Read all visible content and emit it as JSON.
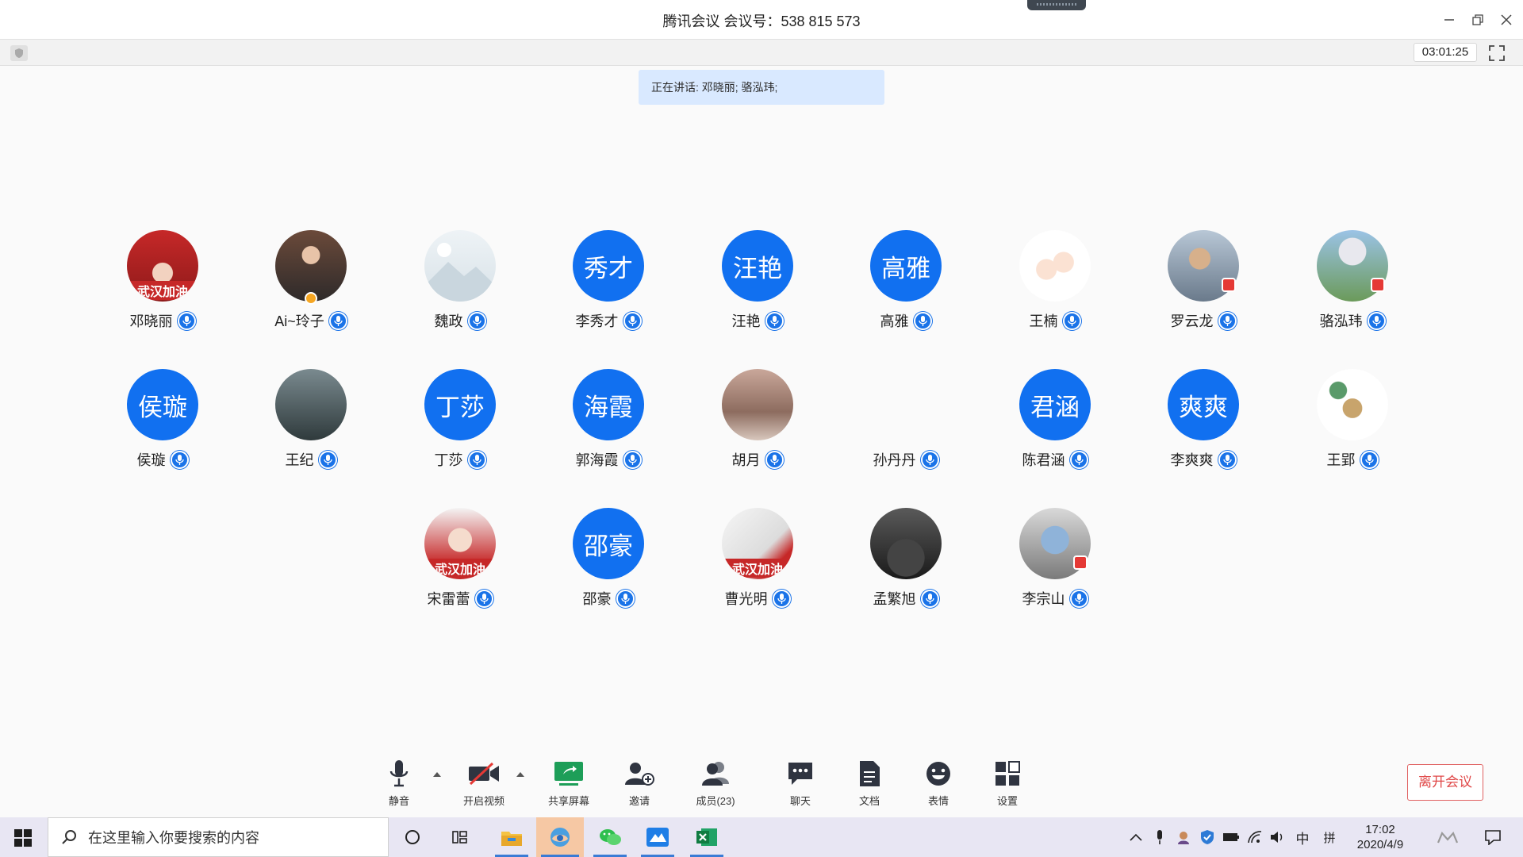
{
  "window": {
    "title": "腾讯会议 会议号：538 815 573",
    "elapsed": "03:01:25"
  },
  "speaking": "正在讲话: 邓晓丽; 骆泓玮;",
  "participants": [
    {
      "name": "邓晓丽",
      "avatar_text": "",
      "avatar_type": "photo"
    },
    {
      "name": "Ai~玲子",
      "avatar_text": "",
      "avatar_type": "photo"
    },
    {
      "name": "魏政",
      "avatar_text": "",
      "avatar_type": "placeholder"
    },
    {
      "name": "李秀才",
      "avatar_text": "秀才",
      "avatar_type": "text"
    },
    {
      "name": "汪艳",
      "avatar_text": "汪艳",
      "avatar_type": "text"
    },
    {
      "name": "高雅",
      "avatar_text": "高雅",
      "avatar_type": "text"
    },
    {
      "name": "王楠",
      "avatar_text": "",
      "avatar_type": "photo"
    },
    {
      "name": "罗云龙",
      "avatar_text": "",
      "avatar_type": "photo"
    },
    {
      "name": "骆泓玮",
      "avatar_text": "",
      "avatar_type": "photo"
    },
    {
      "name": "侯璇",
      "avatar_text": "侯璇",
      "avatar_type": "text"
    },
    {
      "name": "王纪",
      "avatar_text": "",
      "avatar_type": "photo"
    },
    {
      "name": "丁莎",
      "avatar_text": "丁莎",
      "avatar_type": "text"
    },
    {
      "name": "郭海霞",
      "avatar_text": "海霞",
      "avatar_type": "text"
    },
    {
      "name": "胡月",
      "avatar_text": "",
      "avatar_type": "photo"
    },
    {
      "name": "孙丹丹",
      "avatar_text": "",
      "avatar_type": "none"
    },
    {
      "name": "陈君涵",
      "avatar_text": "君涵",
      "avatar_type": "text"
    },
    {
      "name": "李爽爽",
      "avatar_text": "爽爽",
      "avatar_type": "text"
    },
    {
      "name": "王郢",
      "avatar_text": "",
      "avatar_type": "photo"
    },
    {
      "name": "宋雷蕾",
      "avatar_text": "",
      "avatar_type": "photo"
    },
    {
      "name": "邵豪",
      "avatar_text": "邵豪",
      "avatar_type": "text"
    },
    {
      "name": "曹光明",
      "avatar_text": "",
      "avatar_type": "photo"
    },
    {
      "name": "孟繁旭",
      "avatar_text": "",
      "avatar_type": "photo"
    },
    {
      "name": "李宗山",
      "avatar_text": "",
      "avatar_type": "photo"
    }
  ],
  "avatar_overlay_text": {
    "wuhan": "武汉加油"
  },
  "controls": {
    "mute": "静音",
    "video": "开启视频",
    "share": "共享屏幕",
    "invite": "邀请",
    "members": "成员(23)",
    "chat": "聊天",
    "docs": "文档",
    "emoji": "表情",
    "settings": "设置",
    "leave": "离开会议"
  },
  "taskbar": {
    "search_placeholder": "在这里输入你要搜索的内容",
    "ime": "中",
    "ime_mode": "拼",
    "time": "17:02",
    "date": "2020/4/9"
  },
  "colors": {
    "accent": "#1170f0",
    "speaking_bg": "#d9e9ff",
    "leave": "#e04848"
  }
}
